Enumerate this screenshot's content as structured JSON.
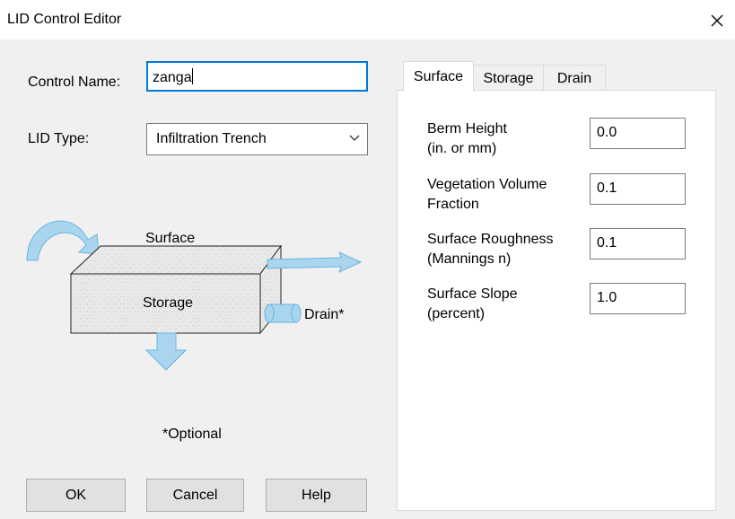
{
  "window": {
    "title": "LID Control Editor",
    "close_icon": "close-icon"
  },
  "form": {
    "control_name_label": "Control Name:",
    "control_name_value": "zanga",
    "lid_type_label": "LID Type:",
    "lid_type_value": "Infiltration Trench"
  },
  "diagram": {
    "surface_label": "Surface",
    "storage_label": "Storage",
    "drain_label": "Drain*",
    "optional_note": "*Optional",
    "arrow_color": "#a9d6ee",
    "arrow_outline": "#6ab3df"
  },
  "buttons": {
    "ok": "OK",
    "cancel": "Cancel",
    "help": "Help"
  },
  "tabs": [
    {
      "label": "Surface",
      "active": true
    },
    {
      "label": "Storage",
      "active": false
    },
    {
      "label": "Drain",
      "active": false
    }
  ],
  "surface_fields": [
    {
      "label_line1": "Berm Height",
      "label_line2": "(in. or mm)",
      "value": "0.0"
    },
    {
      "label_line1": "Vegetation Volume",
      "label_line2": "Fraction",
      "value": "0.1"
    },
    {
      "label_line1": "Surface Roughness",
      "label_line2": "(Mannings n)",
      "value": "0.1"
    },
    {
      "label_line1": "Surface Slope",
      "label_line2": "(percent)",
      "value": "1.0"
    }
  ]
}
